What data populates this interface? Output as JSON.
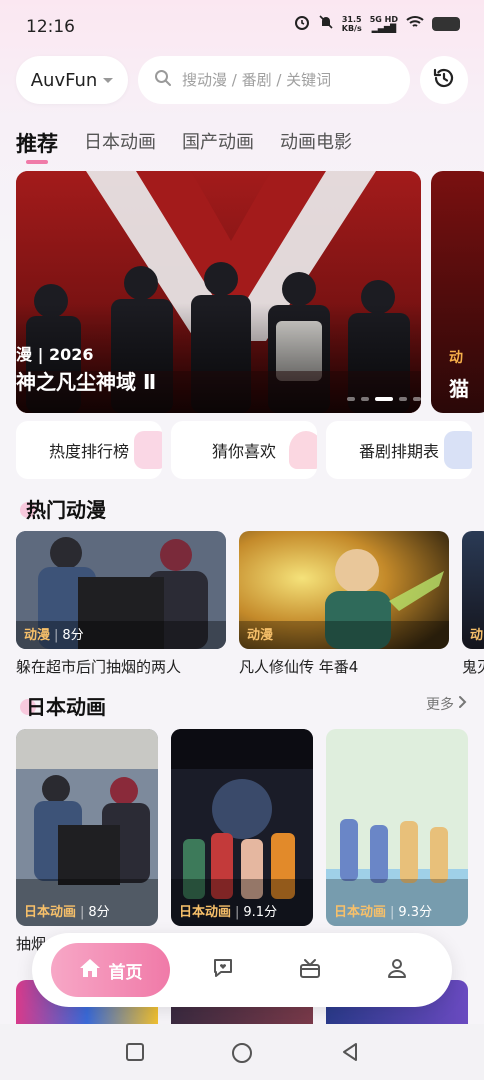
{
  "status": {
    "time": "12:16",
    "speed_value": "31.5",
    "speed_unit": "KB/s",
    "net": "5G HD"
  },
  "header": {
    "source_label": "AuvFun",
    "search_placeholder": "搜动漫 / 番剧 / 关键词"
  },
  "tabs": [
    {
      "label": "推荐",
      "active": true
    },
    {
      "label": "日本动画",
      "active": false
    },
    {
      "label": "国产动画",
      "active": false
    },
    {
      "label": "动画电影",
      "active": false
    }
  ],
  "banner": {
    "meta": "漫 | 2026",
    "title": "神之凡尘神域 Ⅱ",
    "next_meta": "动",
    "next_title": "猫",
    "slide_count": 5,
    "active_slide": 2
  },
  "quick_links": [
    {
      "label": "热度排行榜",
      "icon": "fire-chart-icon"
    },
    {
      "label": "猜你喜欢",
      "icon": "heart-icon"
    },
    {
      "label": "番剧排期表",
      "icon": "calendar-icon"
    }
  ],
  "hot": {
    "title": "热门动漫",
    "items": [
      {
        "tag": "动漫",
        "sub": "8分",
        "caption": "躲在超市后门抽烟的两人"
      },
      {
        "tag": "动漫",
        "sub": "",
        "caption": "凡人修仙传 年番4"
      },
      {
        "tag": "动",
        "sub": "",
        "caption": "鬼灭"
      }
    ]
  },
  "japan": {
    "title": "日本动画",
    "more_label": "更多",
    "items": [
      {
        "tag": "日本动画",
        "score": "8分",
        "caption": "抽烟"
      },
      {
        "tag": "日本动画",
        "score": "9.1分",
        "caption": ""
      },
      {
        "tag": "日本动画",
        "score": "9.3分",
        "caption": ""
      }
    ]
  },
  "nav": {
    "home_label": "首页",
    "items": [
      "home-icon",
      "chat-icon",
      "gift-icon",
      "profile-icon"
    ]
  },
  "colors": {
    "accent": "#f07aa8",
    "tag": "#f7c06a",
    "banner_bg": "#8b1414"
  }
}
